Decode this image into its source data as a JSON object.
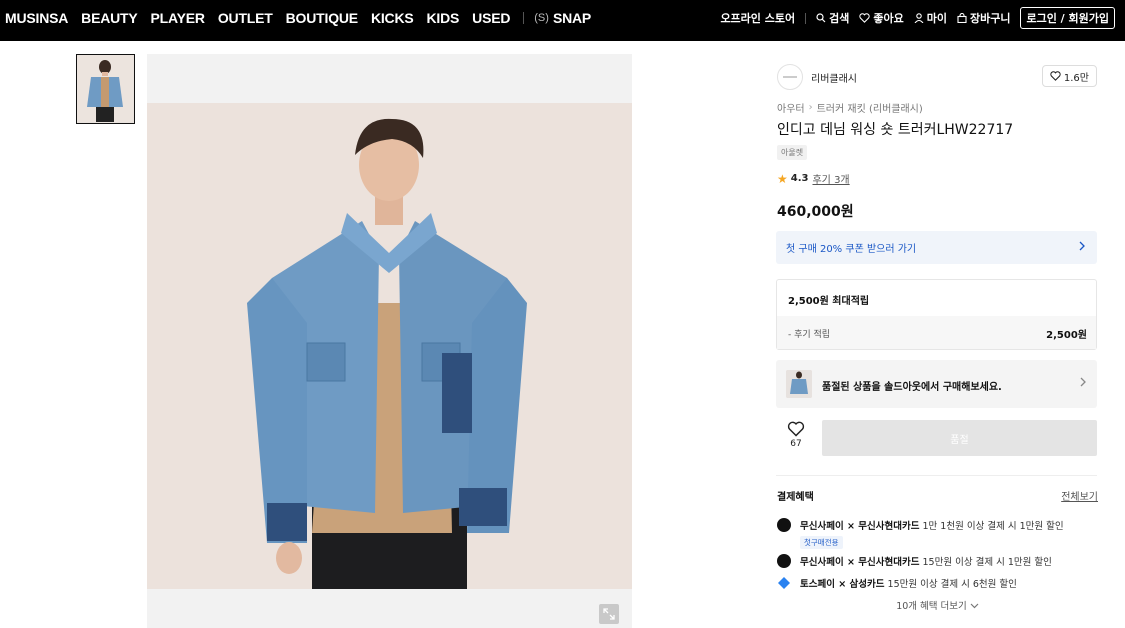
{
  "nav": {
    "items": [
      "MUSINSA",
      "BEAUTY",
      "PLAYER",
      "OUTLET",
      "BOUTIQUE",
      "KICKS",
      "KIDS",
      "USED"
    ],
    "snap_mark": "(S)",
    "snap_label": "SNAP",
    "right": {
      "offline_store": "오프라인 스토어",
      "search": "검색",
      "likes": "좋아요",
      "my": "마이",
      "cart": "장바구니",
      "login": "로그인 / 회원가입"
    }
  },
  "product": {
    "brand_name": "리버클래시",
    "brand_likes": "1.6만",
    "breadcrumb": [
      "아우터",
      "트러커 재킷 (리버클래시)"
    ],
    "title": "인디고 데님 워싱 숏 트러커LHW22717",
    "tag": "아울렛",
    "rating": "4.3",
    "review_link": "후기 3개",
    "price": "460,000원"
  },
  "coupon": {
    "text": "첫 구매 20% 쿠폰 받으러 가기"
  },
  "points": {
    "title": "2,500원 최대적립",
    "sub_label": "- 후기 적립",
    "sub_value": "2,500원"
  },
  "soldout_banner": {
    "text": "품절된 상품을 솔드아웃에서 구매해보세요."
  },
  "actions": {
    "like_count": "67",
    "soldout_button": "품절"
  },
  "benefits": {
    "title": "결제혜택",
    "view_all": "전체보기",
    "items": [
      {
        "prefix": "무신사페이 × 무신사현대카드",
        "text": " 1만 1천원 이상 결제 시 1만원 할인",
        "badge": "첫구매전용"
      },
      {
        "prefix": "무신사페이 × 무신사현대카드",
        "text": " 15만원 이상 결제 시 1만원 할인",
        "badge": ""
      },
      {
        "prefix": "토스페이 × 삼성카드",
        "text": " 15만원 이상 결제 시 6천원 할인",
        "badge": ""
      }
    ],
    "expand": "10개 혜택 더보기"
  },
  "colors": {
    "nav_bg": "#000000",
    "accent_blue": "#1a57c6",
    "star": "#f5a623",
    "denim": "#6f9bc4"
  },
  "icons": [
    "search-icon",
    "heart-icon",
    "person-icon",
    "bag-icon",
    "star-icon",
    "chevron-right-icon",
    "expand-icon",
    "chevron-down-icon"
  ]
}
